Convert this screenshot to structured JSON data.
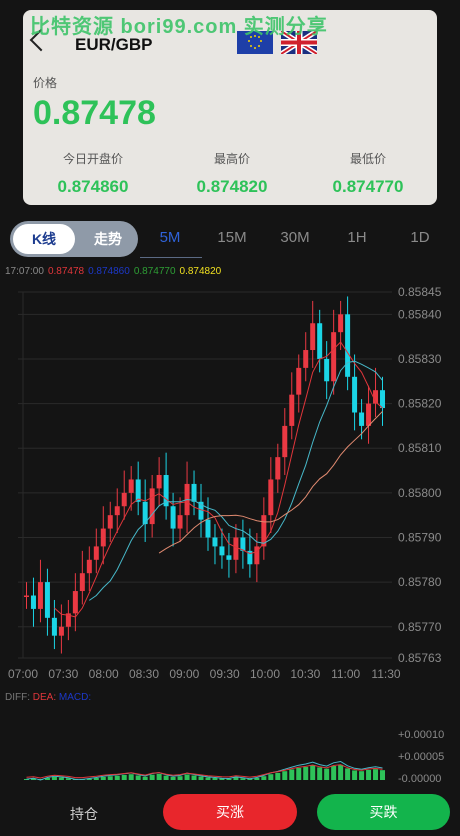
{
  "watermark": "比特资源 bori99.com 实测分享",
  "header": {
    "symbol": "EUR/GBP"
  },
  "price": {
    "label": "价格",
    "value": "0.87478"
  },
  "stats": [
    {
      "label": "今日开盘价",
      "value": "0.874860"
    },
    {
      "label": "最高价",
      "value": "0.874820"
    },
    {
      "label": "最低价",
      "value": "0.874770"
    }
  ],
  "toggle": {
    "kline": "K线",
    "trend": "走势"
  },
  "tabs": [
    "5M",
    "15M",
    "30M",
    "1H",
    "1D"
  ],
  "active_tab": "5M",
  "legend": [
    {
      "text": "17:07:00",
      "color": "#8a8a8a"
    },
    {
      "text": "0.87478",
      "color": "#e0363b"
    },
    {
      "text": "0.874860",
      "color": "#1c38c8"
    },
    {
      "text": "0.874770",
      "color": "#2e9e35"
    },
    {
      "text": "0.874820",
      "color": "#f0e020"
    }
  ],
  "macd_legend": [
    {
      "text": "DIFF:",
      "color": "#777"
    },
    {
      "text": "DEA:",
      "color": "#e0363b"
    },
    {
      "text": "MACD:",
      "color": "#1c38c8"
    }
  ],
  "chart_data": {
    "type": "candlestick",
    "x_ticks": [
      "07:00",
      "07:30",
      "08:00",
      "08:30",
      "09:00",
      "09:30",
      "10:00",
      "10:30",
      "11:00",
      "11:30"
    ],
    "y_ticks": [
      "0.85845",
      "0.85840",
      "0.85830",
      "0.85820",
      "0.85810",
      "0.85800",
      "0.85790",
      "0.85780",
      "0.85770",
      "0.85763"
    ],
    "ylim": [
      0.85763,
      0.85845
    ],
    "macd_ticks": [
      "+0.00010",
      "+0.00005",
      "-0.00000"
    ],
    "colors": {
      "up": "#ea3943",
      "down": "#1bd5e6",
      "macd": "#2ec259"
    }
  },
  "footer": {
    "hold": "持仓",
    "buy": "买涨",
    "sell": "买跌"
  },
  "colors": {
    "buy": "#e8262c",
    "sell": "#13b44c",
    "accent": "#2ec259"
  }
}
